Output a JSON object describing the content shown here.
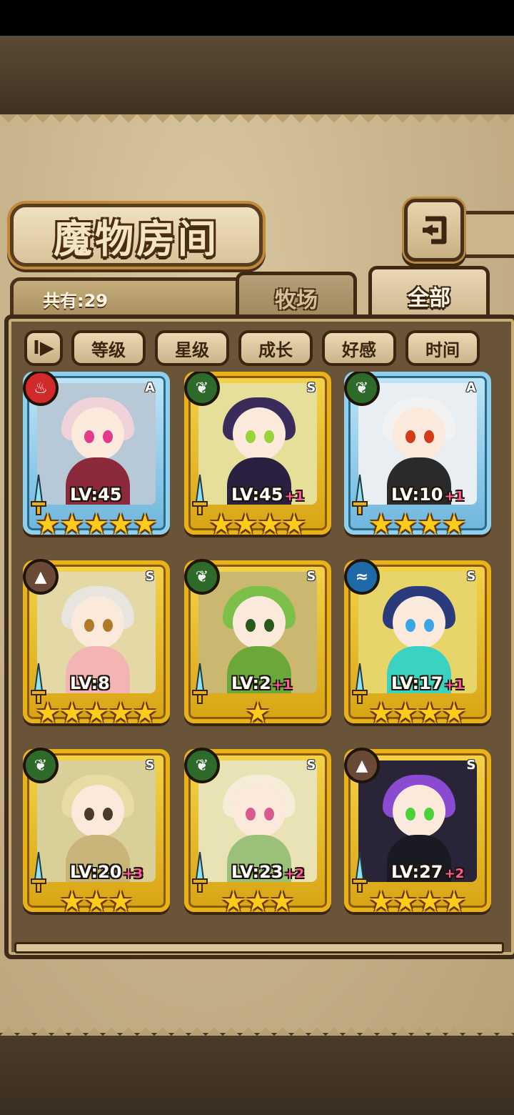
{
  "header": {
    "title": "魔物房间"
  },
  "tabs": {
    "count_label": "共有:29",
    "ranch": "牧场",
    "all": "全部"
  },
  "filters": {
    "sort_icon": "I▶",
    "items": [
      "等级",
      "星级",
      "成长",
      "好感",
      "时间"
    ]
  },
  "monsters": [
    {
      "element": "fire",
      "rank": "A",
      "level": "LV:45",
      "bonus": "",
      "stars": "★★★★★",
      "frame": "blue",
      "palette": {
        "bg": "#b7c9d6",
        "hair": "#f0d3d8",
        "body": "#8a2a3a",
        "eye": "#e43a8a"
      }
    },
    {
      "element": "grass",
      "rank": "S",
      "level": "LV:45",
      "bonus": "+1",
      "stars": "★★★★",
      "frame": "gold",
      "palette": {
        "bg": "#e6df9a",
        "hair": "#3a2c5a",
        "body": "#2a2040",
        "eye": "#9ad23a"
      }
    },
    {
      "element": "grass",
      "rank": "A",
      "level": "LV:10",
      "bonus": "+1",
      "stars": "★★★★",
      "frame": "blue",
      "palette": {
        "bg": "#e8eef2",
        "hair": "#f2f2f2",
        "body": "#2a2a2a",
        "eye": "#d43a1a"
      }
    },
    {
      "element": "earth",
      "rank": "S",
      "level": "LV:8",
      "bonus": "",
      "stars": "★★★★★",
      "frame": "gold",
      "palette": {
        "bg": "#e4d9a6",
        "hair": "#e8e4de",
        "body": "#f3b4b4",
        "eye": "#b07a2a"
      }
    },
    {
      "element": "grass",
      "rank": "S",
      "level": "LV:2",
      "bonus": "+1",
      "stars": "★",
      "frame": "gold",
      "palette": {
        "bg": "#cbb870",
        "hair": "#7cc04a",
        "body": "#6aa83a",
        "eye": "#2a5a1a"
      }
    },
    {
      "element": "water",
      "rank": "S",
      "level": "LV:17",
      "bonus": "+1",
      "stars": "★★★★",
      "frame": "gold",
      "palette": {
        "bg": "#e8d56a",
        "hair": "#2a3a7a",
        "body": "#3ad2c2",
        "eye": "#3aa6e8"
      }
    },
    {
      "element": "grass",
      "rank": "S",
      "level": "LV:20",
      "bonus": "+3",
      "stars": "★★★",
      "frame": "gold",
      "palette": {
        "bg": "#d9cf98",
        "hair": "#e8dca4",
        "body": "#c9b57a",
        "eye": "#4a3a2a"
      }
    },
    {
      "element": "grass",
      "rank": "S",
      "level": "LV:23",
      "bonus": "+2",
      "stars": "★★★",
      "frame": "gold",
      "palette": {
        "bg": "#e9e2b4",
        "hair": "#f6ecd8",
        "body": "#9ac07a",
        "eye": "#d85a8a"
      }
    },
    {
      "element": "earth",
      "rank": "S",
      "level": "LV:27",
      "bonus": "+2",
      "stars": "★★★★",
      "frame": "gold",
      "palette": {
        "bg": "#2a2438",
        "hair": "#8a4ad2",
        "body": "#1a1a22",
        "eye": "#4ad23a"
      }
    }
  ],
  "element_icons": {
    "fire": "fire-icon",
    "grass": "leaf-icon",
    "earth": "mountain-icon",
    "water": "wave-icon"
  },
  "colors": {
    "gold_frame": "#e8b21a",
    "blue_frame": "#8fd0ee",
    "plus_text": "#ff5a9a"
  }
}
